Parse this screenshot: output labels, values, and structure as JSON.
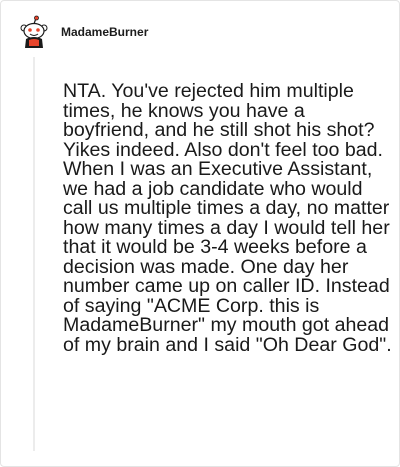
{
  "comment": {
    "username": "MadameBurner",
    "body": "NTA. You've rejected him multiple times, he knows you have a boyfriend, and he still shot his shot? Yikes indeed. Also don't feel too bad. When I was an Executive Assistant, we had a job candidate who would call us multiple times a day, no matter how many times a day I would tell her that it would be 3-4 weeks before a decision was made. One day her number came up on caller ID. Instead of saying \"ACME Corp. this is MadameBurner\" my mouth got ahead of my brain and I said \"Oh Dear God\"."
  },
  "avatar": {
    "icon": "snoo-avatar-icon",
    "colors": {
      "body": "#ffffff",
      "accent": "#e8452c",
      "outline": "#1a1a1a"
    }
  },
  "colors": {
    "thread_line": "#ececec",
    "text": "#1a1a1a"
  }
}
